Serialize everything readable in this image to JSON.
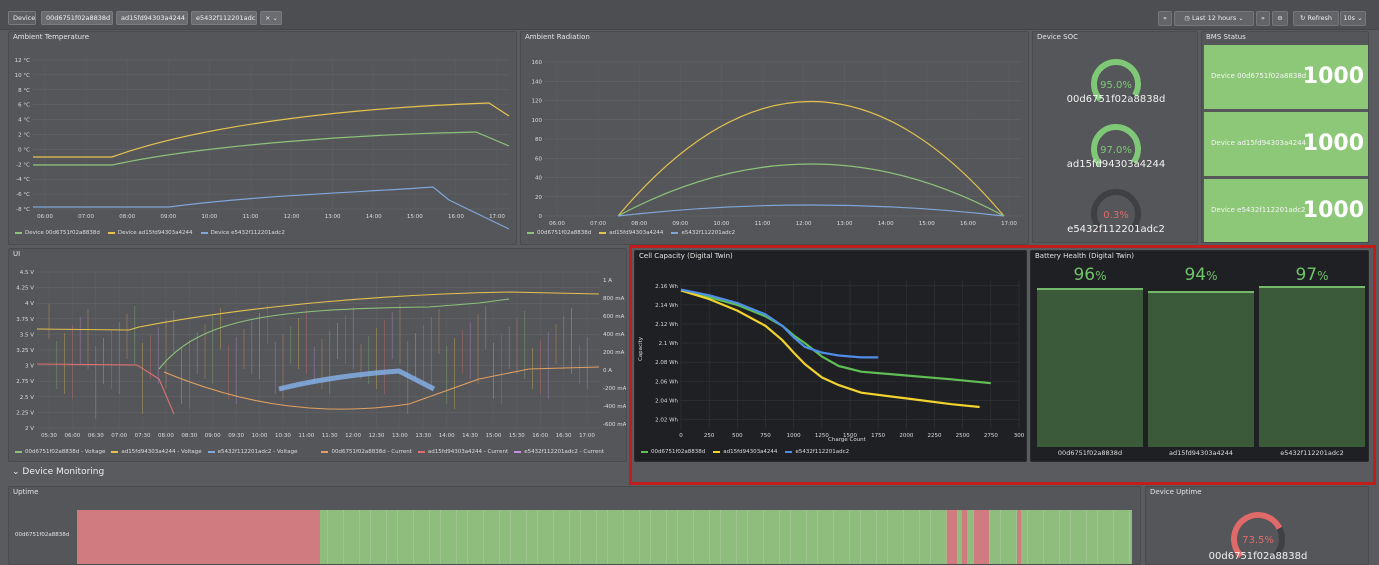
{
  "topbar": {
    "device_label": "Device",
    "devices": [
      "00d6751f02a8838d",
      "ad15fd94303a4244",
      "e5432f112201adc2"
    ],
    "time_range": "Last 12 hours",
    "refresh_label": "Refresh",
    "refresh_interval": "10s"
  },
  "ambient_temperature": {
    "title": "Ambient Temperature",
    "y_ticks": [
      "12 °C",
      "10 °C",
      "8 °C",
      "6 °C",
      "4 °C",
      "2 °C",
      "0 °C",
      "-2 °C",
      "-4 °C",
      "-6 °C",
      "-8 °C"
    ],
    "x_ticks": [
      "06:00",
      "07:00",
      "08:00",
      "09:00",
      "10:00",
      "11:00",
      "12:00",
      "13:00",
      "14:00",
      "15:00",
      "16:00",
      "17:00"
    ],
    "legend": [
      "Device 00d6751f02a8838d",
      "Device ad15fd94303a4244",
      "Device e5432f112201adc2"
    ]
  },
  "ambient_radiation": {
    "title": "Ambient Radiation",
    "y_ticks": [
      "160",
      "140",
      "120",
      "100",
      "80",
      "60",
      "40",
      "20",
      "0"
    ],
    "x_ticks": [
      "06:00",
      "07:00",
      "08:00",
      "09:00",
      "10:00",
      "11:00",
      "12:00",
      "13:00",
      "14:00",
      "15:00",
      "16:00",
      "17:00"
    ],
    "legend": [
      "00d6751f02a8838d",
      "ad15fd94303a4244",
      "e5432f112201adc2"
    ]
  },
  "device_soc": {
    "title": "Device SOC",
    "gauges": [
      {
        "value": "95.0%",
        "name": "00d6751f02a8838d",
        "fraction": 0.95,
        "color": "#7fc877"
      },
      {
        "value": "97.0%",
        "name": "ad15fd94303a4244",
        "fraction": 0.97,
        "color": "#7fc877"
      },
      {
        "value": "0.3%",
        "name": "e5432f112201adc2",
        "fraction": 0.003,
        "color": "#e06a6a"
      }
    ]
  },
  "bms_status": {
    "title": "BMS Status",
    "cells": [
      {
        "label": "Device 00d6751f02a8838d",
        "value": "1000"
      },
      {
        "label": "Device ad15fd94303a4244",
        "value": "1000"
      },
      {
        "label": "Device e5432f112201adc2",
        "value": "1000"
      }
    ]
  },
  "ui_panel": {
    "title": "UI",
    "y_ticks_left": [
      "4.5 V",
      "4.25 V",
      "4 V",
      "3.75 V",
      "3.5 V",
      "3.25 V",
      "3 V",
      "2.75 V",
      "2.5 V",
      "2.25 V",
      "2 V"
    ],
    "y_ticks_right": [
      "1 A",
      "800 mA",
      "600 mA",
      "400 mA",
      "200 mA",
      "0 A",
      "-200 mA",
      "-400 mA",
      "-600 mA"
    ],
    "x_ticks": [
      "05:30",
      "06:00",
      "06:30",
      "07:00",
      "07:30",
      "08:00",
      "08:30",
      "09:00",
      "09:30",
      "10:00",
      "10:30",
      "11:00",
      "11:30",
      "12:00",
      "12:30",
      "13:00",
      "13:30",
      "14:00",
      "14:30",
      "15:00",
      "15:30",
      "16:00",
      "16:30",
      "17:00"
    ],
    "legend": [
      "00d6751f02a8838d - Voltage",
      "ad15fd94303a4244 - Voltage",
      "e5432f112201adc2 - Voltage",
      "00d6751f02a8838d - Current",
      "ad15fd94303a4244 - Current",
      "e5432f112201adc2 - Current"
    ]
  },
  "cell_capacity": {
    "title": "Cell Capacity (Digital Twin)",
    "ylabel": "Capacity",
    "xlabel": "Charge Count",
    "legend": [
      "00d6751f02a8838d",
      "ad15fd94303a4244",
      "e5432f112201adc2"
    ]
  },
  "battery_health": {
    "title": "Battery Health (Digital Twin)",
    "bars": [
      {
        "value": "96",
        "unit": "%",
        "name": "00d6751f02a8838d",
        "fraction": 0.96
      },
      {
        "value": "94",
        "unit": "%",
        "name": "ad15fd94303a4244",
        "fraction": 0.94
      },
      {
        "value": "97",
        "unit": "%",
        "name": "e5432f112201adc2",
        "fraction": 0.97
      }
    ]
  },
  "device_monitoring": {
    "section_label": "Device Monitoring",
    "uptime_title": "Uptime",
    "uptime_row_label": "00d6751f02a8838d",
    "device_uptime_title": "Device Uptime",
    "device_uptime_value": "73.5%",
    "device_uptime_fraction": 0.735,
    "device_uptime_name": "00d6751f02a8838d"
  },
  "chart_data": {
    "type": "line",
    "title": "Cell Capacity (Digital Twin)",
    "xlabel": "Charge Count",
    "ylabel": "Capacity",
    "x_ticks": [
      "0",
      "250",
      "500",
      "750",
      "1000",
      "1250",
      "1500",
      "1750",
      "2000",
      "2250",
      "2500",
      "2750",
      "300"
    ],
    "y_ticks": [
      "2.16 Wh",
      "2.14 Wh",
      "2.12 Wh",
      "2.1 Wh",
      "2.08 Wh",
      "2.06 Wh",
      "2.04 Wh",
      "2.02 Wh"
    ],
    "xlim": [
      0,
      3000
    ],
    "ylim": [
      2.01,
      2.165
    ],
    "grid": true,
    "legend_position": "bottom-left",
    "series": [
      {
        "name": "00d6751f02a8838d",
        "color": "#5fbe55",
        "x": [
          0,
          250,
          500,
          750,
          900,
          1000,
          1100,
          1250,
          1400,
          1600,
          2000,
          2400,
          2750
        ],
        "y": [
          2.155,
          2.148,
          2.14,
          2.128,
          2.118,
          2.108,
          2.1,
          2.086,
          2.076,
          2.07,
          2.066,
          2.062,
          2.058
        ]
      },
      {
        "name": "ad15fd94303a4244",
        "color": "#f1d22f",
        "x": [
          0,
          250,
          500,
          750,
          900,
          1000,
          1100,
          1250,
          1400,
          1600,
          2000,
          2400,
          2650
        ],
        "y": [
          2.155,
          2.146,
          2.134,
          2.118,
          2.103,
          2.09,
          2.078,
          2.064,
          2.056,
          2.048,
          2.042,
          2.036,
          2.033
        ]
      },
      {
        "name": "e5432f112201adc2",
        "color": "#4f8ee8",
        "x": [
          0,
          250,
          500,
          750,
          900,
          1000,
          1100,
          1250,
          1400,
          1600,
          1750
        ],
        "y": [
          2.156,
          2.15,
          2.142,
          2.13,
          2.118,
          2.106,
          2.096,
          2.09,
          2.087,
          2.085,
          2.085
        ]
      }
    ]
  }
}
